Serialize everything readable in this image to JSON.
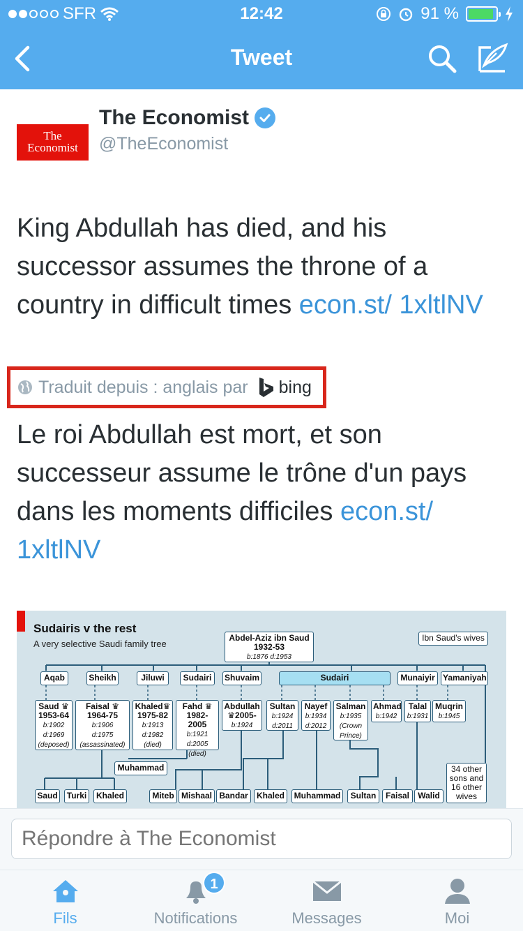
{
  "status": {
    "carrier": "SFR",
    "time": "12:42",
    "battery": "91 %",
    "battery_level": 0.91
  },
  "nav": {
    "title": "Tweet"
  },
  "tweet": {
    "author_name": "The Economist",
    "author_handle": "@TheEconomist",
    "logo_line1": "The",
    "logo_line2": "Economist",
    "text": "King Abdullah has died, and his successor assumes the throne of a country in difficult times ",
    "link": "econ.st/ 1xltlNV",
    "translation_label": "Traduit depuis : anglais par",
    "translation_provider": "bing",
    "translated_text": "Le roi Abdullah est mort, et son successeur assume le trône d'un pays dans les moments difficiles ",
    "translated_link": "econ.st/ 1xltlNV"
  },
  "infographic": {
    "title": "Sudairis v the rest",
    "subtitle": "A very selective Saudi family tree",
    "legend": "Ibn Saud's wives",
    "root": {
      "name": "Abdel-Aziz ibn Saud",
      "reign": "1932-53",
      "dates": "b:1876 d:1953"
    },
    "wives": [
      "Aqab",
      "Sheikh",
      "Jiluwi",
      "Sudairi",
      "Shuvaim",
      "Sudairi",
      "Munaiyir",
      "Yamaniyah"
    ],
    "sons": [
      {
        "name": "Saud",
        "reign": "1953-64",
        "b": "b:1902",
        "d": "d:1969",
        "note": "(deposed)"
      },
      {
        "name": "Faisal",
        "reign": "1964-75",
        "b": "b:1906",
        "d": "d:1975",
        "note": "(assassinated)"
      },
      {
        "name": "Khaled",
        "reign": "1975-82",
        "b": "b:1913",
        "d": "d:1982",
        "note": "(died)"
      },
      {
        "name": "Fahd",
        "reign": "1982-2005",
        "b": "b:1921",
        "d": "d:2005",
        "note": "(died)"
      },
      {
        "name": "Abdullah",
        "reign": "2005-",
        "b": "b:1924",
        "d": "",
        "note": ""
      },
      {
        "name": "Sultan",
        "reign": "",
        "b": "b:1924",
        "d": "d:2011",
        "note": ""
      },
      {
        "name": "Nayef",
        "reign": "",
        "b": "b:1934",
        "d": "d:2012",
        "note": ""
      },
      {
        "name": "Salman",
        "reign": "",
        "b": "b:1935",
        "d": "(Crown",
        "note": "Prince)"
      },
      {
        "name": "Ahmad",
        "reign": "",
        "b": "b:1942",
        "d": "",
        "note": ""
      },
      {
        "name": "Talal",
        "reign": "",
        "b": "b:1931",
        "d": "",
        "note": ""
      },
      {
        "name": "Muqrin",
        "reign": "",
        "b": "b:1945",
        "d": "",
        "note": ""
      }
    ],
    "muhammad_mid": "Muhammad",
    "others": "34 other sons and 16 other wives",
    "grandsons": [
      "Saud",
      "Turki",
      "Khaled",
      "Miteb",
      "Mishaal",
      "Bandar",
      "Khaled",
      "Muhammad",
      "Sultan",
      "Faisal",
      "Walid"
    ]
  },
  "reply": {
    "placeholder": "Répondre à The Economist"
  },
  "tabs": [
    {
      "label": "Fils"
    },
    {
      "label": "Notifications",
      "badge": "1"
    },
    {
      "label": "Messages"
    },
    {
      "label": "Moi"
    }
  ],
  "colors": {
    "brand": "#55acee",
    "link": "#3b94d9",
    "highlight_box": "#d8261b",
    "economist_red": "#e3120b"
  }
}
